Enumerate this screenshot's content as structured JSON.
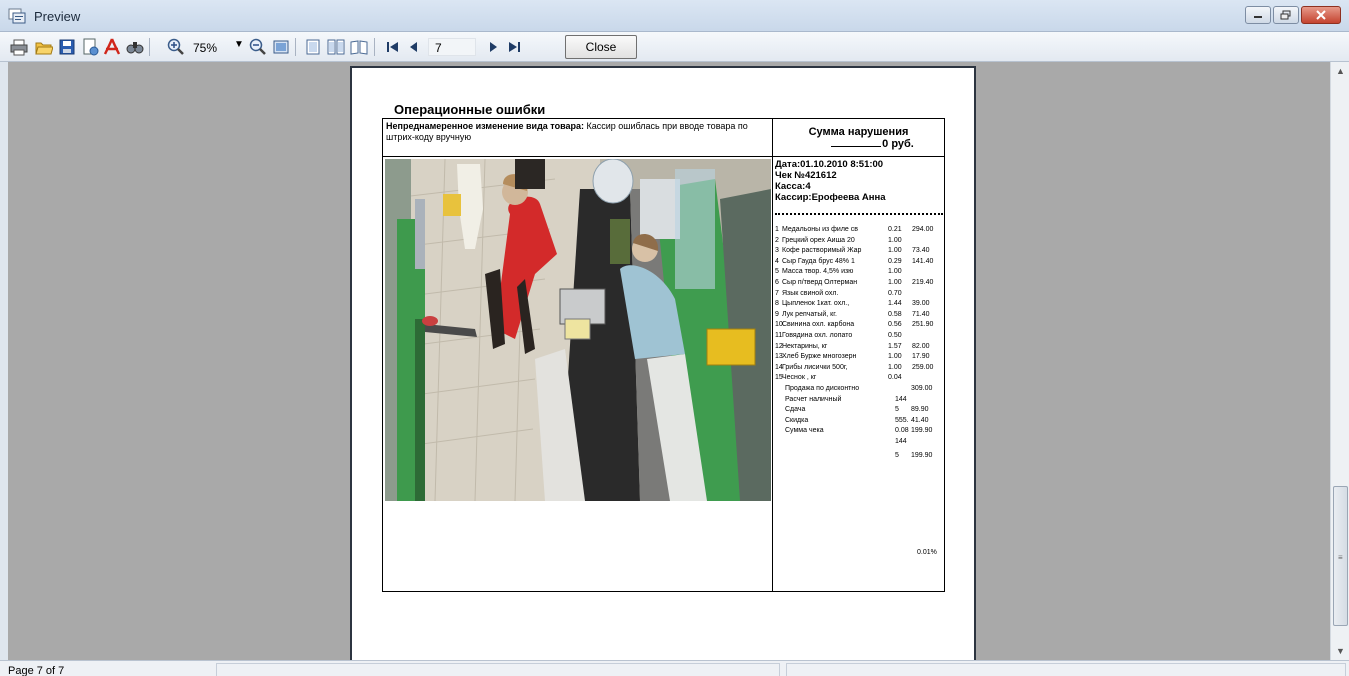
{
  "window": {
    "title": "Preview"
  },
  "toolbar": {
    "zoom_value": "75%",
    "page_number": "7",
    "close_label": "Close",
    "icons": [
      "print-icon",
      "open-icon",
      "save-icon",
      "page-setup-icon",
      "pdf-export-icon",
      "find-icon",
      "zoom-in-icon",
      "zoom-out-icon",
      "full-page-icon",
      "single-page-icon",
      "two-pages-icon",
      "multiple-pages-icon",
      "first-page-icon",
      "previous-page-icon",
      "next-page-icon",
      "last-page-icon"
    ]
  },
  "report": {
    "heading": "Операционные ошибки",
    "desc_bold": "Непреднамеренное изменение вида товара:",
    "desc_text": " Кассир ошиблась при вводе товара по штрих-коду вручную",
    "sum_title": "Сумма нарушения",
    "sum_value": "0 руб.",
    "date": "Дата:01.10.2010 8:51:00",
    "check": "Чек №421612",
    "register": "Касса:4",
    "cashier": "Кассир:Ерофеева Анна",
    "items": [
      {
        "n": "1",
        "name": "Медальоны из филе св",
        "qty": "0.21",
        "price": "294.00"
      },
      {
        "n": "2",
        "name": "Грецкий орех Аиша 20",
        "qty": "1.00",
        "price": ""
      },
      {
        "n": "3",
        "name": "Кофе растворимый Жар",
        "qty": "1.00",
        "price": "73.40"
      },
      {
        "n": "4",
        "name": "Сыр Гауда брус 48% 1",
        "qty": "0.29",
        "price": "141.40"
      },
      {
        "n": "5",
        "name": "Масса твор. 4,5% изю",
        "qty": "1.00",
        "price": ""
      },
      {
        "n": "6",
        "name": "Сыр п/тверд Олтерман",
        "qty": "1.00",
        "price": "219.40"
      },
      {
        "n": "7",
        "name": "Язык свиной охл.",
        "qty": "0.70",
        "price": ""
      },
      {
        "n": "8",
        "name": "Цыпленок 1кат. охл.,",
        "qty": "1.44",
        "price": "39.00"
      },
      {
        "n": "9",
        "name": "Лук репчатый, кг.",
        "qty": "0.58",
        "price": "71.40"
      },
      {
        "n": "10",
        "name": "Свинина охл. карбона",
        "qty": "0.56",
        "price": "251.90"
      },
      {
        "n": "11",
        "name": "Говядина охл. лопато",
        "qty": "0.50",
        "price": ""
      },
      {
        "n": "12",
        "name": "Нектарины, кг",
        "qty": "1.57",
        "price": "82.00"
      },
      {
        "n": "13",
        "name": "Хлеб Бурже многозерн",
        "qty": "1.00",
        "price": "17.90"
      },
      {
        "n": "14",
        "name": "Грибы лисички 500г,",
        "qty": "1.00",
        "price": "259.00"
      },
      {
        "n": "15",
        "name": "Чеснок , кг",
        "qty": "0.04",
        "price": ""
      }
    ],
    "summary": [
      {
        "name": "Продажа по дисконтно",
        "qty": "",
        "price": "309.00"
      },
      {
        "name": "Расчет наличный",
        "qty": "144",
        "price": ""
      },
      {
        "name": "Сдача",
        "qty": "5",
        "price": "89.90"
      },
      {
        "name": "Скидка",
        "qty": "555.",
        "price": "41.40"
      },
      {
        "name": "Сумма чека",
        "qty": "0.08",
        "price": "199.90"
      },
      {
        "name": "",
        "qty": "144",
        "price": ""
      },
      {
        "name": "",
        "qty": "5",
        "price": "199.90"
      }
    ],
    "percent": "0.01%"
  },
  "status": {
    "page_info": "Page 7 of 7"
  }
}
